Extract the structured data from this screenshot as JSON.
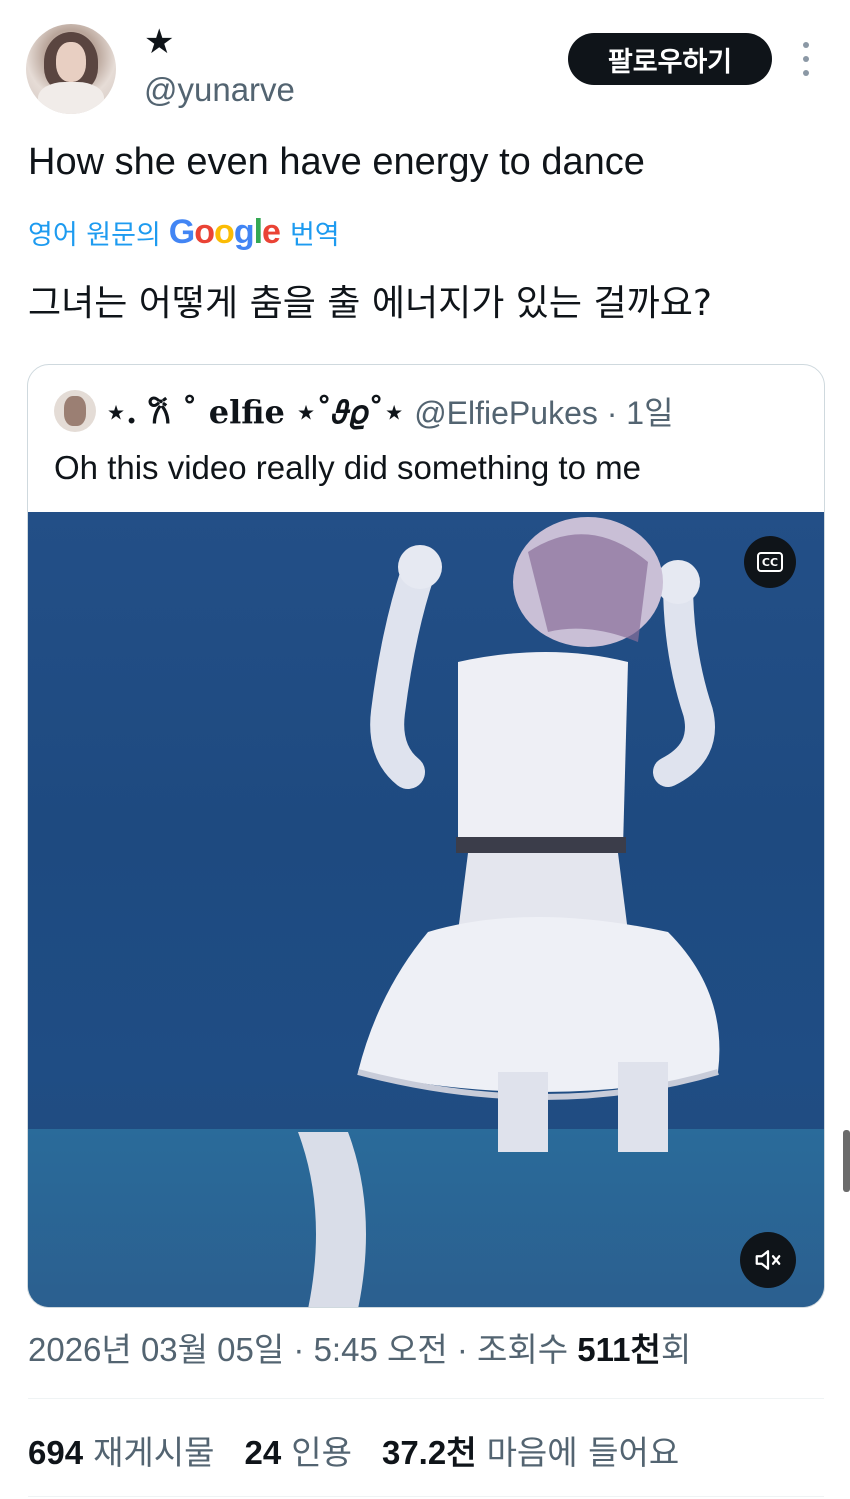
{
  "author": {
    "display_name": "★",
    "handle": "@yunarve",
    "avatar_icon": "profile-photo"
  },
  "follow_button": {
    "label": "팔로우하기"
  },
  "more_menu": {
    "icon": "more-vertical-icon"
  },
  "tweet": {
    "text": "How she even have energy to dance",
    "translation_notice_prefix": "영어 원문의",
    "translation_notice_brand": "Google",
    "translation_notice_suffix": "번역",
    "translated_text": "그녀는 어떻게 춤을 출 에너지가 있는 걸까요?"
  },
  "quoted_tweet": {
    "display_name": "⋆. 𐙚 ˚ elfie ⋆˚𝜗𝜚˚⋆",
    "handle_time": "@ElfiePukes · 1일",
    "text": "Oh this video really did something to me",
    "video": {
      "captions_label": "CC",
      "captions_icon": "closed-captions-icon",
      "sound_icon": "speaker-muted-icon"
    }
  },
  "meta": {
    "date_time": "2026년 03월 05일 · 5:45 오전 · 조회수 ",
    "views_value": "511천",
    "views_suffix": "회"
  },
  "stats": [
    {
      "value": "694",
      "label": "재게시물"
    },
    {
      "value": "24",
      "label": "인용"
    },
    {
      "value": "37.2천",
      "label": "마음에 들어요"
    }
  ],
  "colors": {
    "text_primary": "#0f1419",
    "text_secondary": "#536471",
    "link": "#1d9bf0",
    "button_bg": "#0f1419",
    "border": "#cfd9de",
    "video_bg": "#1f4d84"
  }
}
